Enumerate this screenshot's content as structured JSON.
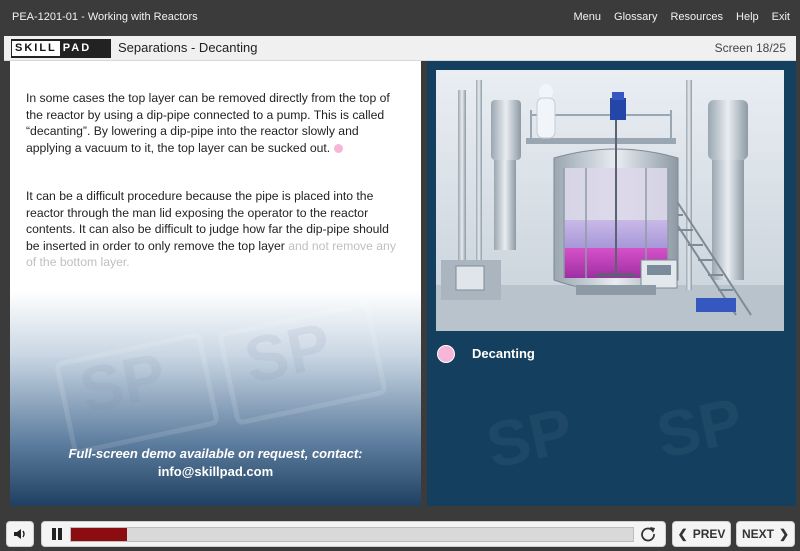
{
  "window": {
    "course_title": "PEA-1201-01 - Working with Reactors",
    "nav": [
      "Menu",
      "Glossary",
      "Resources",
      "Help",
      "Exit"
    ]
  },
  "header": {
    "logo_part1": "SKILL",
    "logo_part2": "PAD",
    "lesson_title": "Separations - Decanting",
    "screen_counter": "Screen 18/25"
  },
  "content": {
    "paragraph1": "In some cases the top layer can be removed directly from the top of the reactor by using a dip-pipe connected to a pump. This is called “decanting”. By lowering a dip-pipe into the reactor slowly and applying a vacuum to it, the top layer can be sucked out.",
    "paragraph2_visible": "It can be a difficult procedure because the pipe is placed into the reactor through the man lid exposing the operator to the reactor contents. It can also be difficult to judge how far the dip-pipe should be inserted in order to only remove the top layer",
    "paragraph2_faded": "and not remove any of the bottom layer.",
    "demo_line1": "Full-screen demo available on request, contact:",
    "demo_line2": "info@skillpad.com",
    "watermark_text": "SP"
  },
  "media": {
    "image_icon": "reactor-illustration",
    "caption": "Decanting",
    "hotspot_color": "#f7b6d8"
  },
  "player": {
    "progress": 0.1,
    "prev_label": "PREV",
    "next_label": "NEXT",
    "accent": "#8b0d12"
  }
}
